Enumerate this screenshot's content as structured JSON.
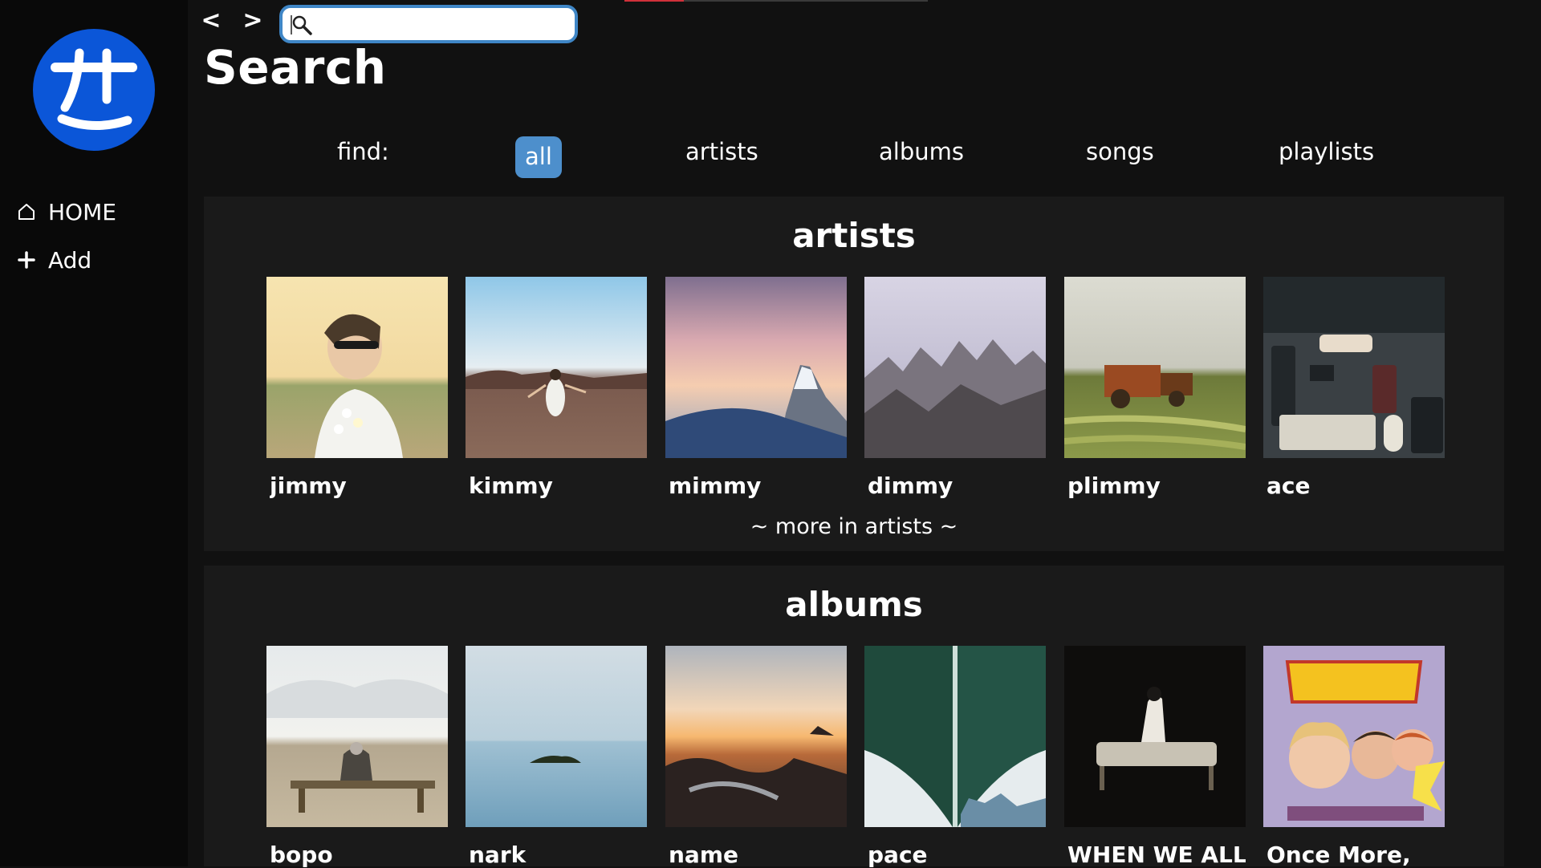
{
  "sidebar": {
    "logo_alt": "",
    "items": [
      {
        "label": "HOME",
        "icon": "home-icon"
      },
      {
        "label": "Add",
        "icon": "plus-icon"
      }
    ]
  },
  "header": {
    "back_label": "<",
    "forward_label": ">",
    "search_value": "",
    "search_placeholder": "",
    "title": "Search"
  },
  "filters": {
    "label": "find:",
    "tabs": [
      "all",
      "artists",
      "albums",
      "songs",
      "playlists"
    ],
    "active": "all"
  },
  "artists": {
    "title": "artists",
    "items": [
      "jimmy",
      "kimmy",
      "mimmy",
      "dimmy",
      "plimmy",
      "ace"
    ],
    "more_label": "~ more in artists ~"
  },
  "albums": {
    "title": "albums",
    "items": [
      "bopo",
      "nark",
      "name",
      "pace",
      "WHEN WE ALL",
      "Once More,"
    ]
  },
  "colors": {
    "background": "#111111",
    "sidebar": "#090909",
    "panel": "#1a1a1a",
    "accent": "#4d8fcc",
    "logo": "#0b56d8"
  }
}
